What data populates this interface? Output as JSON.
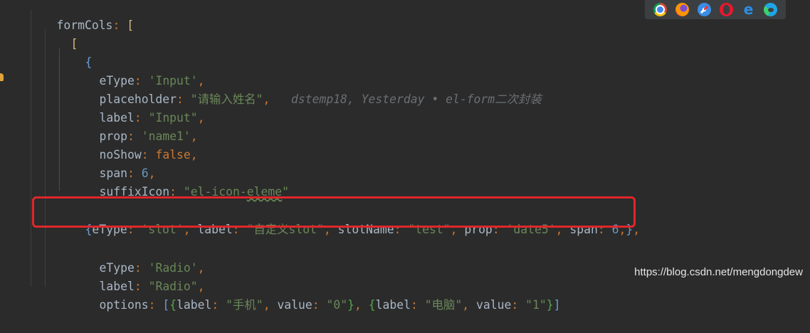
{
  "code": {
    "line_formcols": {
      "key": "formCols",
      "colon": ":",
      "bracket": "["
    },
    "line_open_array": {
      "bracket": "["
    },
    "line_open_obj1": {
      "brace": "{"
    },
    "line_etype_input": {
      "key": "eType",
      "colon": ":",
      "value": "'Input'",
      "comma": ","
    },
    "line_placeholder": {
      "key": "placeholder",
      "colon": ":",
      "value": "\"请输入姓名\"",
      "comma": ","
    },
    "line_label_input": {
      "key": "label",
      "colon": ":",
      "value": "\"Input\"",
      "comma": ","
    },
    "line_prop_name1": {
      "key": "prop",
      "colon": ":",
      "value": "'name1'",
      "comma": ","
    },
    "line_noshow": {
      "key": "noShow",
      "colon": ":",
      "value": "false",
      "comma": ","
    },
    "line_span6": {
      "key": "span",
      "colon": ":",
      "value": "6",
      "comma": ","
    },
    "line_suffixicon": {
      "key": "suffixIcon",
      "colon": ":",
      "value_pre": "\"el-icon-",
      "value_warn": "eleme",
      "value_post": "\""
    },
    "line_close_obj1": {
      "brace": "}",
      "comma": ","
    },
    "line_slot": {
      "brace_open": "{",
      "k1": "eType",
      "v1": "'slot'",
      "k2": "label",
      "v2": "\"自定义slot\"",
      "k3": "slotName",
      "v3": "\"test\"",
      "k4": "prop",
      "v4": "'date5'",
      "k5": "span",
      "v5": "6",
      "brace_close": "}"
    },
    "line_open_obj3": {
      "brace": "{"
    },
    "line_etype_radio": {
      "key": "eType",
      "colon": ":",
      "value": "'Radio'",
      "comma": ","
    },
    "line_label_radio": {
      "key": "label",
      "colon": ":",
      "value": "\"Radio\"",
      "comma": ","
    },
    "line_options": {
      "key": "options",
      "colon": ":",
      "o1_label": "\"手机\"",
      "o1_value": "\"0\"",
      "o2_label": "\"电脑\"",
      "o2_value": "\"1\""
    }
  },
  "blame": {
    "text": "dstemp18, Yesterday • el-form二次封装"
  },
  "browsers": [
    "chrome-icon",
    "firefox-icon",
    "safari-icon",
    "opera-icon",
    "ie-icon",
    "edge-icon"
  ],
  "watermark": "https://blog.csdn.net/mengdongdew",
  "colors": {
    "background": "#2b2b2b",
    "string": "#6a8759",
    "keyword": "#cc7832",
    "number": "#6897bb",
    "highlight_box": "#e0262a"
  }
}
